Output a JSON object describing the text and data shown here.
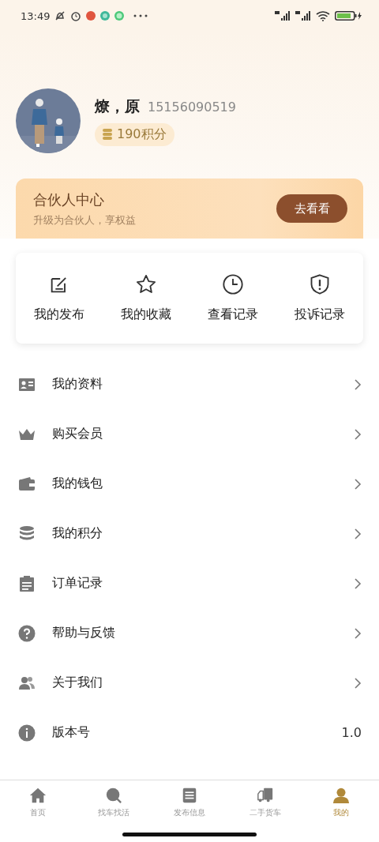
{
  "status_bar": {
    "time": "13:49"
  },
  "profile": {
    "name": "燎，原",
    "phone": "15156090519",
    "points": "190积分"
  },
  "partner": {
    "title": "合伙人中心",
    "subtitle": "升级为合伙人，享权益",
    "button": "去看看"
  },
  "quick_actions": [
    {
      "label": "我的发布"
    },
    {
      "label": "我的收藏"
    },
    {
      "label": "查看记录"
    },
    {
      "label": "投诉记录"
    }
  ],
  "menu": [
    {
      "label": "我的资料",
      "kind": "link"
    },
    {
      "label": "购买会员",
      "kind": "link"
    },
    {
      "label": "我的钱包",
      "kind": "link"
    },
    {
      "label": "我的积分",
      "kind": "link"
    },
    {
      "label": "订单记录",
      "kind": "link"
    },
    {
      "label": "帮助与反馈",
      "kind": "link"
    },
    {
      "label": "关于我们",
      "kind": "link"
    },
    {
      "label": "版本号",
      "kind": "value",
      "value": "1.0"
    }
  ],
  "tab_bar": [
    {
      "label": "首页",
      "selected": false
    },
    {
      "label": "找车找活",
      "selected": false
    },
    {
      "label": "发布信息",
      "selected": false
    },
    {
      "label": "二手货车",
      "selected": false
    },
    {
      "label": "我的",
      "selected": true
    }
  ]
}
